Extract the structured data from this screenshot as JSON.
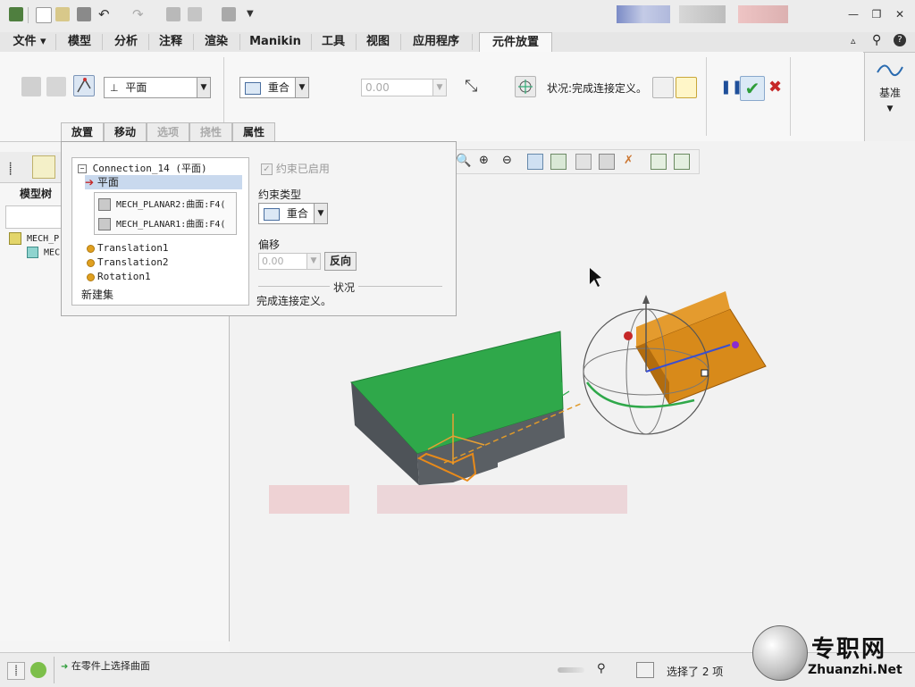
{
  "ribbon_tabs": [
    "文件",
    "模型",
    "分析",
    "注释",
    "渲染",
    "Manikin",
    "工具",
    "视图",
    "应用程序",
    "元件放置"
  ],
  "toolbar": {
    "connection_type": "平面",
    "constraint_type": "重合",
    "offset_value": "0.00",
    "status_label": "状况:完成连接定义。",
    "datum_label": "基准"
  },
  "panel_tabs": [
    "放置",
    "移动",
    "选项",
    "挠性",
    "属性"
  ],
  "placement": {
    "connection": "Connection_14 (平面)",
    "selected_item": "平面",
    "refs": [
      "MECH_PLANAR2:曲面:F4(",
      "MECH_PLANAR1:曲面:F4("
    ],
    "motion_axes": [
      "Translation1",
      "Translation2",
      "Rotation1"
    ],
    "new_set": "新建集",
    "constraint_enabled": "约束已启用",
    "constraint_type_label": "约束类型",
    "constraint_type": "重合",
    "offset_label": "偏移",
    "offset_value": "0.00",
    "flip_button": "反向",
    "status_heading": "状况",
    "status_text": "完成连接定义。"
  },
  "model_tree": {
    "title": "模型树",
    "items": [
      "MECH_P",
      "MEC"
    ]
  },
  "statusbar": {
    "message": "在零件上选择曲面",
    "selection": "选择了 2 项"
  },
  "watermark": {
    "text": "专职网",
    "url": "Zhuanzhi.Net"
  },
  "colors": {
    "ribbon_bg": "#f7f7f7",
    "green_part": "#2fa84a",
    "orange_part": "#d88a1a",
    "accent_red": "#c62828",
    "accept_green": "#2e9d3a"
  }
}
